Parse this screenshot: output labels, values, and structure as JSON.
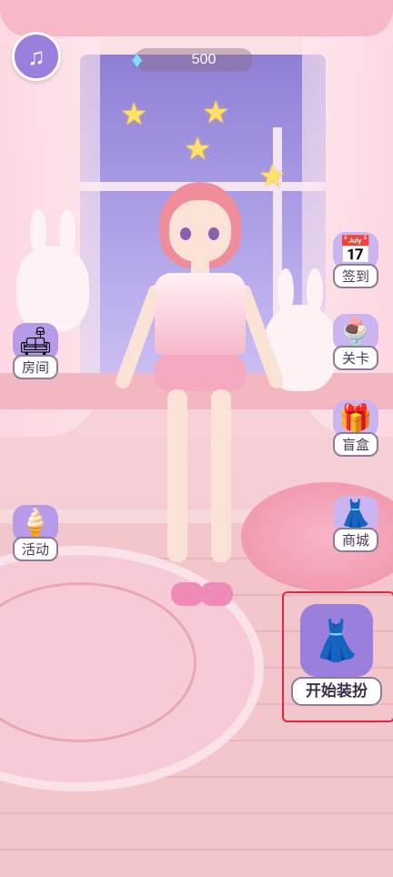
{
  "header": {
    "music_icon": "music-note-icon",
    "gem_icon": "diamond-icon",
    "gem_count": "500"
  },
  "left_menu": [
    {
      "label": "房间",
      "icon": "sofa-icon"
    },
    {
      "label": "活动",
      "icon": "ice-cream-icon"
    }
  ],
  "right_menu": [
    {
      "label": "签到",
      "icon": "calendar-icon"
    },
    {
      "label": "关卡",
      "icon": "ice-cream-cone-icon"
    },
    {
      "label": "盲盒",
      "icon": "gift-box-icon"
    },
    {
      "label": "商城",
      "icon": "dress-stand-icon"
    }
  ],
  "start_dressup": {
    "label": "开始装扮",
    "icon": "dress-globe-icon",
    "highlight_color": "#e2283f"
  },
  "colors": {
    "accent": "#9a7fdc",
    "floor": "#f2c6ca"
  }
}
